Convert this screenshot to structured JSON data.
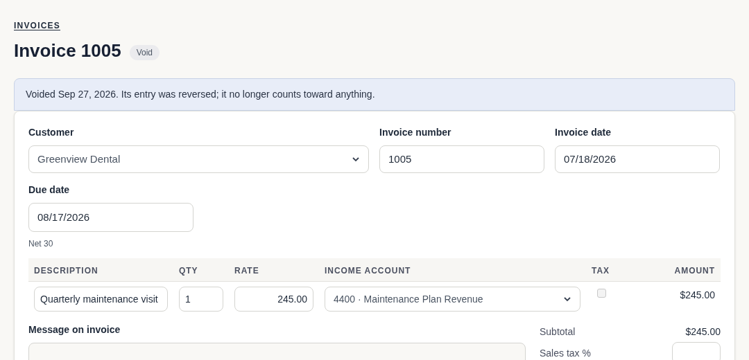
{
  "breadcrumb": "INVOICES",
  "title": "Invoice 1005",
  "status_badge": "Void",
  "notice": "Voided Sep 27, 2026. Its entry was reversed; it no longer counts toward anything.",
  "fields": [
    {
      "label": "Customer",
      "value": "Greenview Dental",
      "kind": "select"
    },
    {
      "label": "Invoice number",
      "value": "1005",
      "kind": "input"
    },
    {
      "label": "Invoice date",
      "value": "07/18/2026",
      "kind": "input"
    }
  ],
  "due_date": {
    "label": "Due date",
    "value": "08/17/2026",
    "hint": "Net 30"
  },
  "table": {
    "columns": [
      "DESCRIPTION",
      "QTY",
      "RATE",
      "INCOME ACCOUNT",
      "TAX",
      "AMOUNT"
    ],
    "rows": [
      {
        "description": "Quarterly maintenance visit",
        "qty": "1",
        "rate": "245.00",
        "account": "4400 · Maintenance Plan Revenue",
        "tax": false,
        "amount": "$245.00"
      }
    ]
  },
  "message": {
    "label": "Message on invoice"
  },
  "totals": [
    {
      "label": "Subtotal",
      "value": "$245.00"
    },
    {
      "label": "Sales tax %"
    }
  ]
}
